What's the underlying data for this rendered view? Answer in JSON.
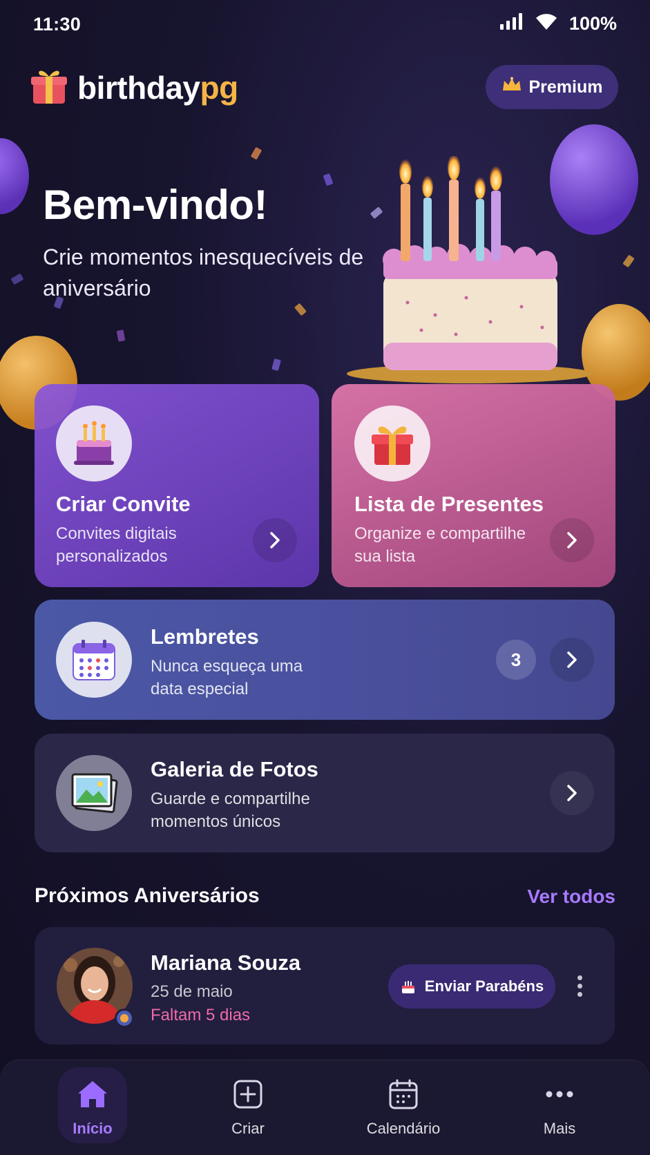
{
  "status_bar": {
    "time": "11:30",
    "battery": "100%"
  },
  "header": {
    "logo_main": "birthday",
    "logo_accent": "pg",
    "premium_label": "Premium"
  },
  "hero": {
    "title": "Bem-vindo!",
    "subtitle": "Crie momentos inesquecíveis de aniversário"
  },
  "cards": {
    "invite": {
      "title": "Criar Convite",
      "desc": "Convites digitais personalizados"
    },
    "gifts": {
      "title": "Lista de Presentes",
      "desc": "Organize e compartilhe sua lista"
    },
    "reminders": {
      "title": "Lembretes",
      "desc": "Nunca esqueça uma data especial",
      "badge": "3"
    },
    "gallery": {
      "title": "Galeria de Fotos",
      "desc": "Guarde e compartilhe momentos únicos"
    }
  },
  "upcoming": {
    "title": "Próximos Aniversários",
    "see_all": "Ver todos",
    "people": [
      {
        "name": "Mariana Souza",
        "date": "25 de maio",
        "countdown": "Faltam 5 dias",
        "action": "Enviar Parabéns"
      }
    ]
  },
  "nav": {
    "items": [
      {
        "label": "Início",
        "icon": "home-icon"
      },
      {
        "label": "Criar",
        "icon": "plus-square-icon"
      },
      {
        "label": "Calendário",
        "icon": "calendar-icon"
      },
      {
        "label": "Mais",
        "icon": "more-icon"
      }
    ]
  },
  "colors": {
    "accent": "#a77bff",
    "logo_accent": "#f5b445",
    "pink_text": "#ef6ba8"
  }
}
